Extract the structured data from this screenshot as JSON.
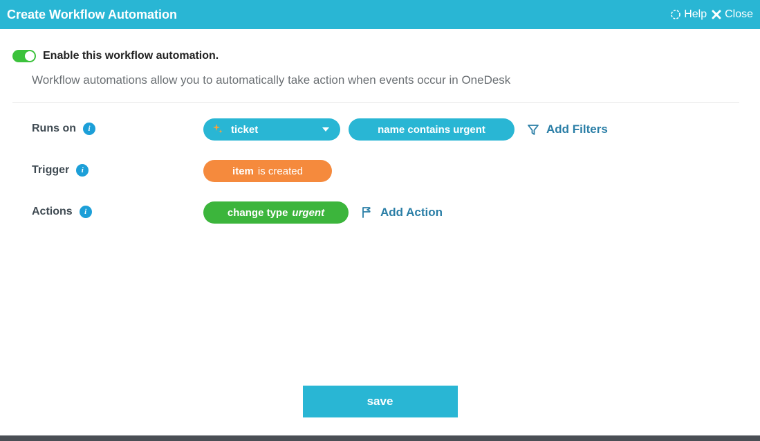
{
  "header": {
    "title": "Create Workflow Automation",
    "help": "Help",
    "close": "Close"
  },
  "enable": {
    "label": "Enable this workflow automation."
  },
  "description": "Workflow automations allow you to automatically take action when events occur in OneDesk",
  "labels": {
    "runs_on": "Runs on",
    "trigger": "Trigger",
    "actions": "Actions"
  },
  "runs_on": {
    "type": "ticket",
    "filter": "name contains urgent",
    "add_filters": "Add Filters"
  },
  "trigger": {
    "subject": "item",
    "event": "is created"
  },
  "action": {
    "verb": "change type",
    "value": "urgent",
    "add_action": "Add Action"
  },
  "buttons": {
    "save": "save"
  },
  "info_glyph": "i"
}
